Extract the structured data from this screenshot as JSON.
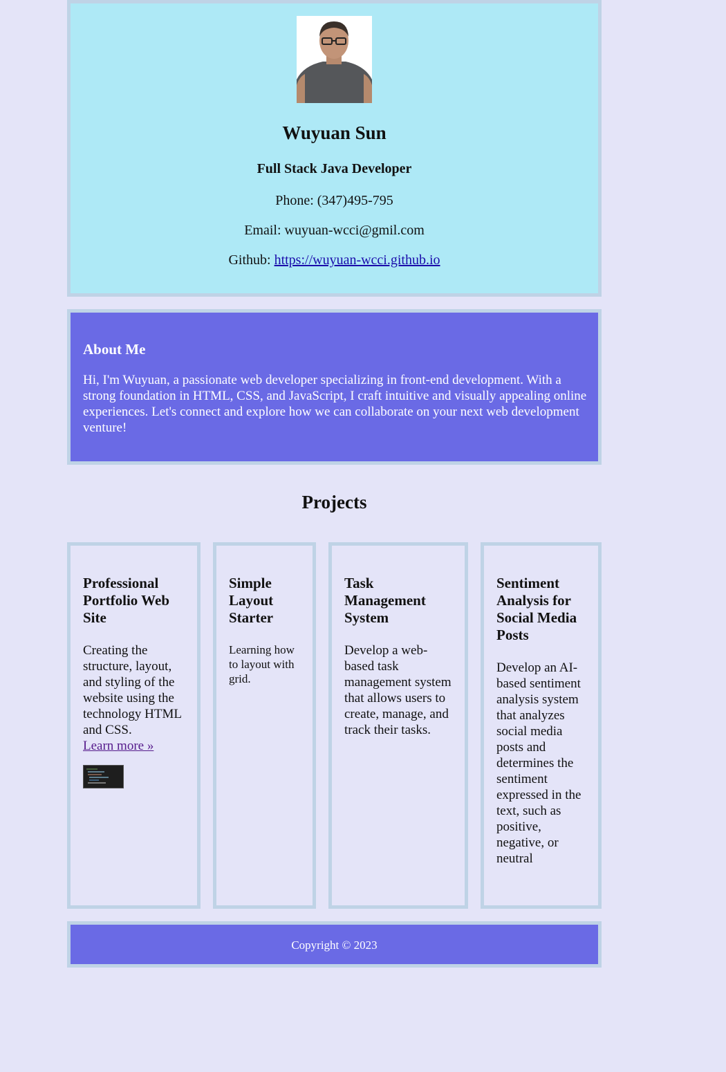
{
  "header": {
    "name": "Wuyuan Sun",
    "title": "Full Stack Java Developer",
    "phone": "Phone: (347)495-795",
    "email": "Email: wuyuan-wcci@gmil.com",
    "github_label": "Github: ",
    "github_link": "https://wuyuan-wcci.github.io"
  },
  "about": {
    "heading": "About Me",
    "text": "Hi, I'm Wuyuan, a passionate web developer specializing in front-end development. With a strong foundation in HTML, CSS, and JavaScript, I craft intuitive and visually appealing online experiences. Let's connect and explore how we can collaborate on your next web development venture!"
  },
  "projects": {
    "heading": "Projects",
    "items": [
      {
        "title": "Professional Portfolio Web Site",
        "description": "Creating the structure, layout, and styling of the website using the technology HTML and CSS.",
        "link": "Learn more »"
      },
      {
        "title": "Simple Layout Starter",
        "description": "Learning how to layout with grid."
      },
      {
        "title": "Task Management System",
        "description": "Develop a web-based task management system that allows users to create, manage, and track their tasks."
      },
      {
        "title": "Sentiment Analysis for Social Media Posts",
        "description": "Develop an AI-based sentiment analysis system that analyzes social media posts and determines the sentiment expressed in the text, such as positive, negative, or neutral"
      }
    ]
  },
  "footer": {
    "copyright": "Copyright © 2023"
  },
  "colors": {
    "page_bg": "#e4e4f8",
    "header_bg": "#aee9f6",
    "accent_bg": "#6a6ae5",
    "border": "#bfd3e6"
  }
}
